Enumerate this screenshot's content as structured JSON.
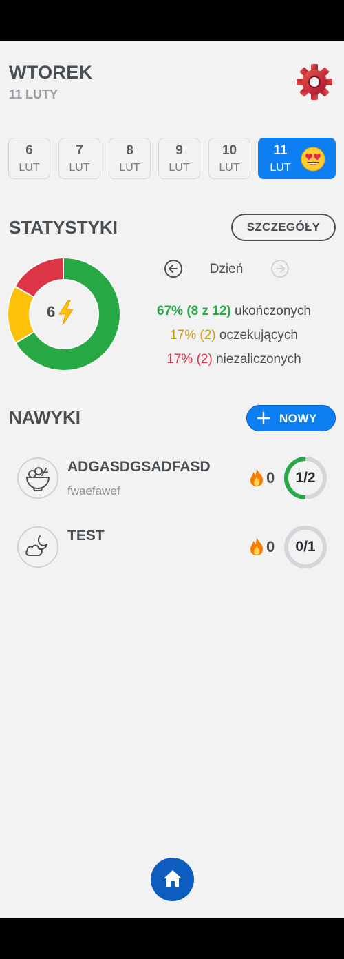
{
  "header": {
    "day_name": "WTOREK",
    "date": "11 LUTY"
  },
  "dates": [
    {
      "day": "6",
      "month": "LUT"
    },
    {
      "day": "7",
      "month": "LUT"
    },
    {
      "day": "8",
      "month": "LUT"
    },
    {
      "day": "9",
      "month": "LUT"
    },
    {
      "day": "10",
      "month": "LUT"
    },
    {
      "day": "11",
      "month": "LUT",
      "selected": true
    }
  ],
  "stats": {
    "title": "STATYSTYKI",
    "details_label": "SZCZEGÓŁY",
    "period": "Dzień",
    "center_value": "6",
    "completed_pct": "67% (8 z 12)",
    "completed_label": "ukończonych",
    "pending_pct": "17% (2)",
    "pending_label": "oczekujących",
    "failed_pct": "17% (2)",
    "failed_label": "niezaliczonych",
    "completed_fraction": 0.667,
    "pending_fraction": 0.167,
    "failed_fraction": 0.167,
    "colors": {
      "completed": "#28a745",
      "pending": "#ffc107",
      "failed": "#dc3545"
    }
  },
  "habits": {
    "title": "NAWYKI",
    "new_label": "NOWY",
    "items": [
      {
        "name": "ADGASDGSADFASD",
        "description": "fwaefawef",
        "streak": "0",
        "progress": "1/2",
        "progress_fraction": 0.5,
        "icon": "salad-bowl-icon"
      },
      {
        "name": "TEST",
        "description": "",
        "streak": "0",
        "progress": "0/1",
        "progress_fraction": 0,
        "icon": "moon-cloud-icon"
      }
    ]
  },
  "nav": {
    "home_icon": "home-icon"
  }
}
